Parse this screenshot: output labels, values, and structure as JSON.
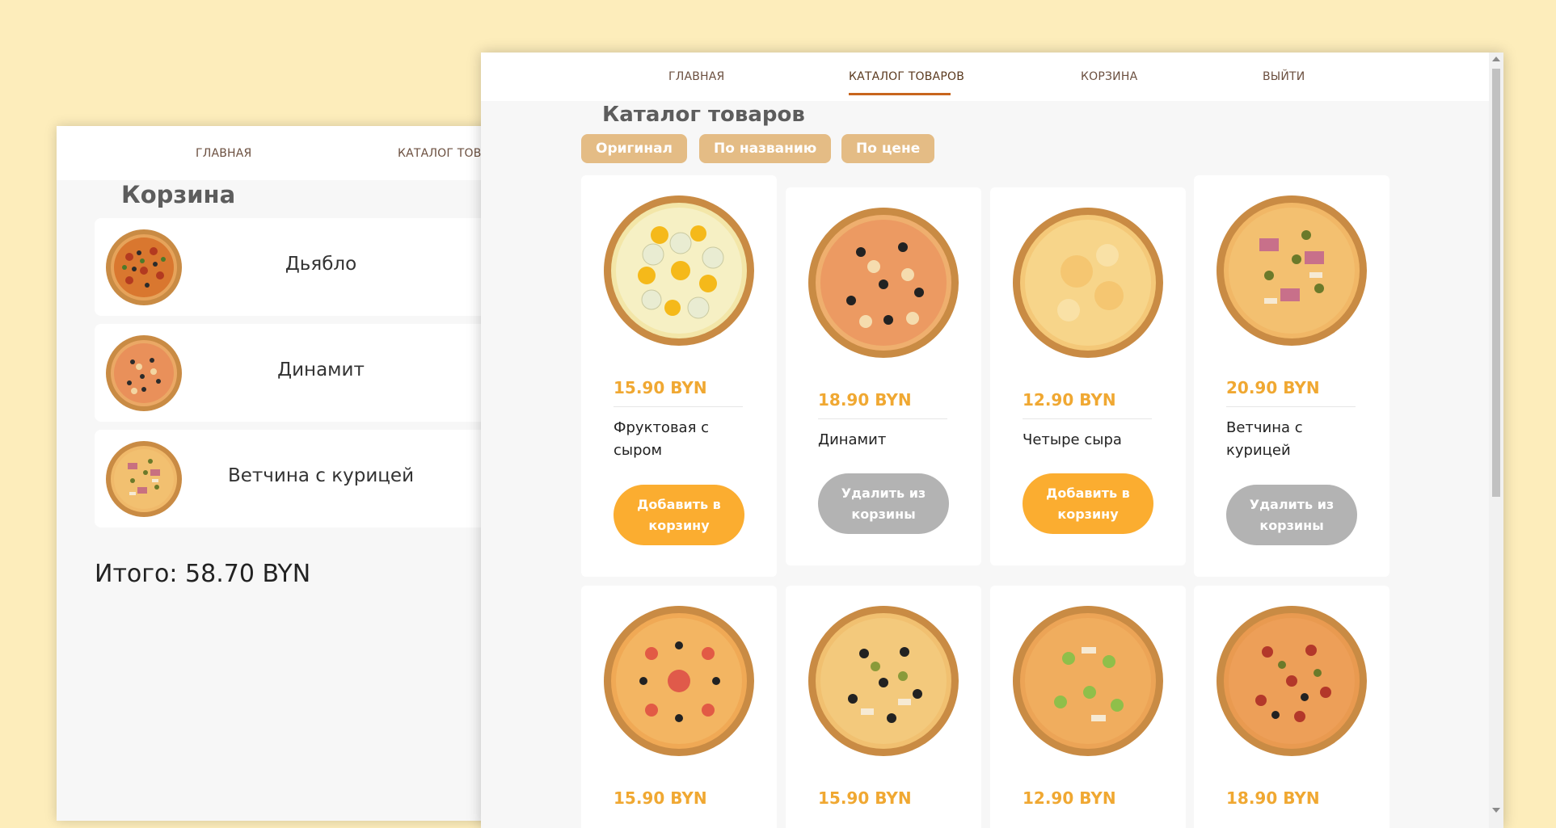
{
  "cart_window": {
    "nav": [
      "ГЛАВНАЯ",
      "КАТАЛОГ ТОВАРОВ"
    ],
    "title": "Корзина",
    "items": [
      {
        "name": "Дьябло"
      },
      {
        "name": "Динамит"
      },
      {
        "name": "Ветчина с курицей"
      }
    ],
    "total": "Итого: 58.70 BYN"
  },
  "catalog_window": {
    "nav": [
      "ГЛАВНАЯ",
      "КАТАЛОГ ТОВАРОВ",
      "КОРЗИНА",
      "ВЫЙТИ"
    ],
    "active_nav": "КАТАЛОГ ТОВАРОВ",
    "title": "Каталог товаров",
    "sort_buttons": [
      "Оригинал",
      "По названию",
      "По цене"
    ],
    "products": [
      {
        "price": "15.90 BYN",
        "name": "Фруктовая с сыром",
        "button": "Добавить в корзину",
        "state": "add"
      },
      {
        "price": "18.90 BYN",
        "name": "Динамит",
        "button": "Удалить из корзины",
        "state": "remove"
      },
      {
        "price": "12.90 BYN",
        "name": "Четыре сыра",
        "button": "Добавить в корзину",
        "state": "add"
      },
      {
        "price": "20.90 BYN",
        "name": "Ветчина с курицей",
        "button": "Удалить из корзины",
        "state": "remove"
      },
      {
        "price": "15.90 BYN"
      },
      {
        "price": "15.90 BYN"
      },
      {
        "price": "12.90 BYN"
      },
      {
        "price": "18.90 BYN"
      }
    ]
  },
  "colors": {
    "background": "#fdedbb",
    "accent": "#fbad30",
    "price": "#f0a832",
    "sort_button": "#e4bc85",
    "remove_button": "#b3b3b3",
    "nav_underline": "#c8651d"
  }
}
